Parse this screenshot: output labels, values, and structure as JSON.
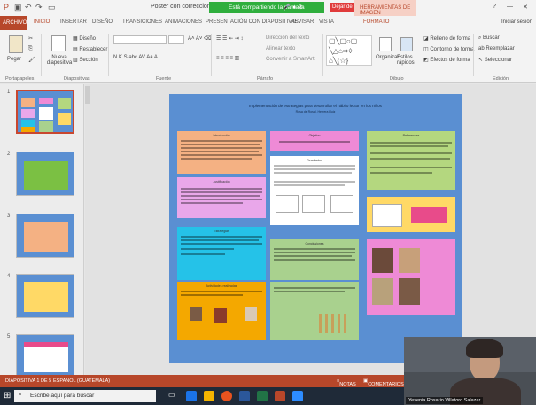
{
  "window": {
    "title": "Poster con correcciones - PowerPoint",
    "share_banner": "Está compartiendo la pantalla",
    "stop_button": "Dejar de",
    "context_tab": "HERRAMIENTAS DE IMAGEN",
    "signin": "Iniciar sesión",
    "controls": [
      "?",
      "—",
      "✕"
    ]
  },
  "tabs": [
    {
      "label": "ARCHIVO",
      "active": false
    },
    {
      "label": "INICIO",
      "active": true
    },
    {
      "label": "INSERTAR",
      "active": false
    },
    {
      "label": "DISEÑO",
      "active": false
    },
    {
      "label": "TRANSICIONES",
      "active": false
    },
    {
      "label": "ANIMACIONES",
      "active": false
    },
    {
      "label": "PRESENTACIÓN CON DIAPOSITIVAS",
      "active": false
    },
    {
      "label": "REVISAR",
      "active": false
    },
    {
      "label": "VISTA",
      "active": false
    },
    {
      "label": "FORMATO",
      "active": false
    }
  ],
  "ribbon": {
    "paste": "Pegar",
    "new_slide": "Nueva diapositiva",
    "layout": "Diseño",
    "reset": "Restablecer",
    "section": "Sección",
    "font_name": "",
    "font_size": "",
    "font_tools": "N  K  S  abc AV  Aa  A",
    "text_direction": "Dirección del texto",
    "align_text": "Alinear texto",
    "convert_smartart": "Convertir a SmartArt",
    "arrange": "Organizar",
    "quick_styles": "Estilos rápidos",
    "shape_fill": "Relleno de forma",
    "shape_outline": "Contorno de forma",
    "shape_effects": "Efectos de forma",
    "find": "Buscar",
    "replace": "Reemplazar",
    "select": "Seleccionar",
    "groups": [
      "Portapapeles",
      "Diapositivas",
      "Fuente",
      "Párrafo",
      "Dibujo",
      "Edición"
    ]
  },
  "slides": [
    {
      "number": "1",
      "selected": true
    },
    {
      "number": "2",
      "selected": false
    },
    {
      "number": "3",
      "selected": false
    },
    {
      "number": "4",
      "selected": false
    },
    {
      "number": "5",
      "selected": false
    }
  ],
  "poster": {
    "title": "Implementación de estrategias para desarrollar el hábito lector en los niños",
    "authors": "Rosa de Rosal, Herrera Ruiz",
    "sections": {
      "intro": "Introducción",
      "justification": "Justificación",
      "objective": "Objetivo",
      "strategy": "Estrategias",
      "results": "Resultados",
      "conclusions": "Conclusiones",
      "references": "Referencias",
      "activities": "Actividades realizadas"
    }
  },
  "status": {
    "slide_counter": "DIAPOSITIVA 1 DE 5",
    "language": "ESPAÑOL (GUATEMALA)",
    "notes": "NOTAS",
    "comments": "COMENTARIOS"
  },
  "taskbar": {
    "search_placeholder": "Escribe aquí para buscar"
  },
  "webcam": {
    "label": "Yesenia Rosario Villatoro Salazar"
  }
}
